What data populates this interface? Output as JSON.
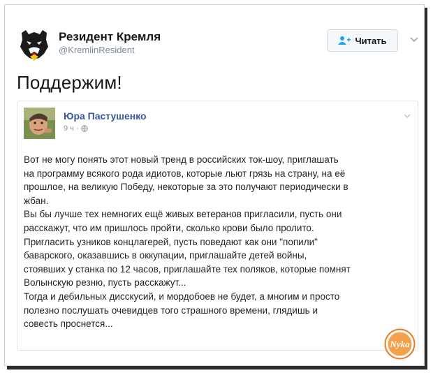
{
  "tweet": {
    "author_name": "Резидент Кремля",
    "author_handle": "@KremlinResident",
    "follow_label": "Читать",
    "text": "Поддержим!"
  },
  "embedded_post": {
    "author": "Юра Пастушенко",
    "time": "9 ч",
    "dot": "·",
    "lines": [
      "Вот не могу понять этот новый тренд в российских ток-шоу, приглашать",
      "на программу всякого рода идиотов, которые льют грязь на страну, на её",
      "прошлое, на великую Победу, некоторые за это получают периодически в",
      "жбан.",
      "Вы бы лучше тех немногих ещё живых ветеранов пригласили, пусть они",
      "расскажут, что им пришлось пройти, сколько крови было пролито.",
      "Пригласить узников концлагерей, пусть поведают как они \"попили\"",
      "баварского, оказавшись в оккупации, приглашайте детей войны,",
      "стоявших у станка по 12 часов, приглашайте тех поляков, которые помнят",
      "Волынскую резню, пусть расскажут...",
      "Тогда и дебильных дисскусий, и мордобоев не будет, а многим и просто",
      "полезно послушать очевидцев того страшного времени, глядишь и",
      "совесть проснется..."
    ]
  },
  "watermark": {
    "text": "Nyka",
    "color": "#e8791e"
  },
  "icons": {
    "avatar": "bear-logo-icon",
    "follow": "add-user-icon",
    "caret": "chevron-down-icon",
    "privacy": "globe-icon"
  },
  "colors": {
    "name_link": "#365899",
    "follow_blue": "#1da1f2",
    "handle_gray": "#7d8a96"
  }
}
